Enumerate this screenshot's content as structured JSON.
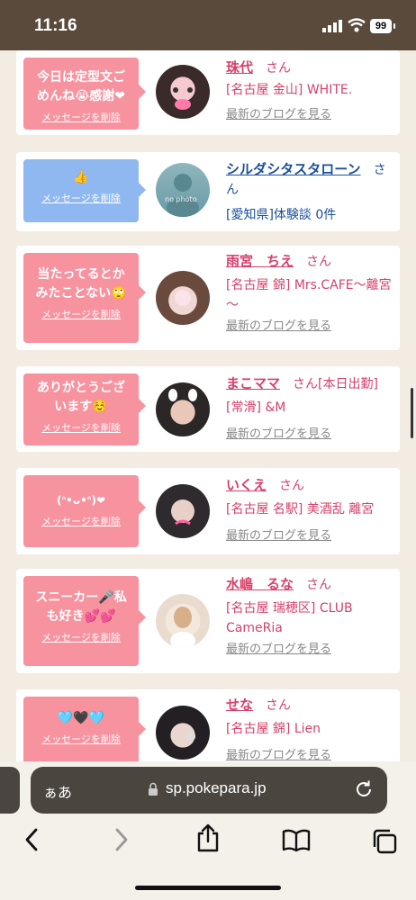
{
  "status": {
    "time": "11:16",
    "battery": "99"
  },
  "messages": [
    {
      "bubble": "今日は定型文ごめんね😭感謝❤",
      "delete": "メッセージを削除",
      "name": "珠代",
      "san": "さん",
      "shop": "[名古屋 金山] WHITE.",
      "blog": "最新のブログを見る",
      "bubble_color": "pink"
    },
    {
      "bubble": "👍",
      "delete": "メッセージを削除",
      "name": "シルダシタスタローン",
      "san": "さん",
      "shop": "[愛知県]体験談 0件",
      "blog": "",
      "bubble_color": "blue",
      "avatar_text": "no photo"
    },
    {
      "bubble": "当たってるとかみたことない🙄",
      "delete": "メッセージを削除",
      "name": "雨宮　ちえ",
      "san": "さん",
      "shop": "[名古屋 錦] Mrs.CAFE～離宮～",
      "blog": "最新のブログを見る",
      "bubble_color": "pink"
    },
    {
      "bubble": "ありがとうございます☺️",
      "delete": "メッセージを削除",
      "name": "まこママ",
      "san": "さん[本日出勤]",
      "shop": "[常滑] &M",
      "blog": "最新のブログを見る",
      "bubble_color": "pink"
    },
    {
      "bubble": "(ᐢ•ᴗ•ᐢ)❤",
      "delete": "メッセージを削除",
      "name": "いくえ",
      "san": "さん",
      "shop": "[名古屋 名駅] 美酒乱 離宮",
      "blog": "最新のブログを見る",
      "bubble_color": "pink"
    },
    {
      "bubble": "スニーカー🎤私も好き💕💕",
      "delete": "メッセージを削除",
      "name": "水嶋　るな",
      "san": "さん",
      "shop": "[名古屋 瑞穂区] CLUB CameRia",
      "blog": "最新のブログを見る",
      "bubble_color": "pink"
    },
    {
      "bubble": "🩵🖤🩵",
      "delete": "メッセージを削除",
      "name": "せな",
      "san": "さん",
      "shop": "[名古屋 錦] Lien",
      "blog": "最新のブログを見る",
      "bubble_color": "pink"
    }
  ],
  "browser": {
    "aa": "ぁあ",
    "url": "sp.pokepara.jp"
  },
  "icons": {
    "back": "chevron-left-icon",
    "forward": "chevron-right-icon",
    "share": "share-icon",
    "bookmarks": "book-icon",
    "tabs": "tabs-icon",
    "lock": "lock-icon",
    "reload": "reload-icon"
  }
}
